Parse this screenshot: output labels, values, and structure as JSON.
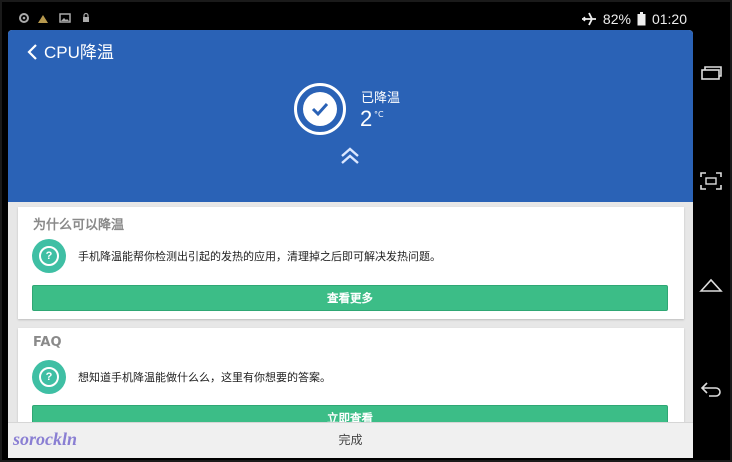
{
  "status_bar": {
    "battery": "82%",
    "time": "01:20"
  },
  "header": {
    "title": "CPU降温",
    "status_label": "已降温",
    "temp_value": "2",
    "temp_unit": "°C"
  },
  "cards": [
    {
      "title": "为什么可以降温",
      "text": "手机降温能帮你检测出引起的发热的应用，清理掉之后即可解决发热问题。",
      "button": "查看更多"
    },
    {
      "title": "FAQ",
      "text": "想知道手机降温能做什么么，这里有你想要的答案。",
      "button": "立即查看"
    }
  ],
  "footer": {
    "done": "完成"
  },
  "watermark": "sorockln",
  "colors": {
    "header": "#2a62b6",
    "button": "#3cbd87",
    "icon": "#3fbfa4"
  },
  "icons": [
    "settings-icon",
    "image-icon",
    "photo-icon",
    "lock-icon",
    "airplane-icon",
    "battery-icon",
    "back-arrow-icon",
    "check-icon",
    "chevron-up-double-icon",
    "question-icon",
    "recent-apps-icon",
    "screenshot-icon",
    "home-icon",
    "back-icon"
  ]
}
